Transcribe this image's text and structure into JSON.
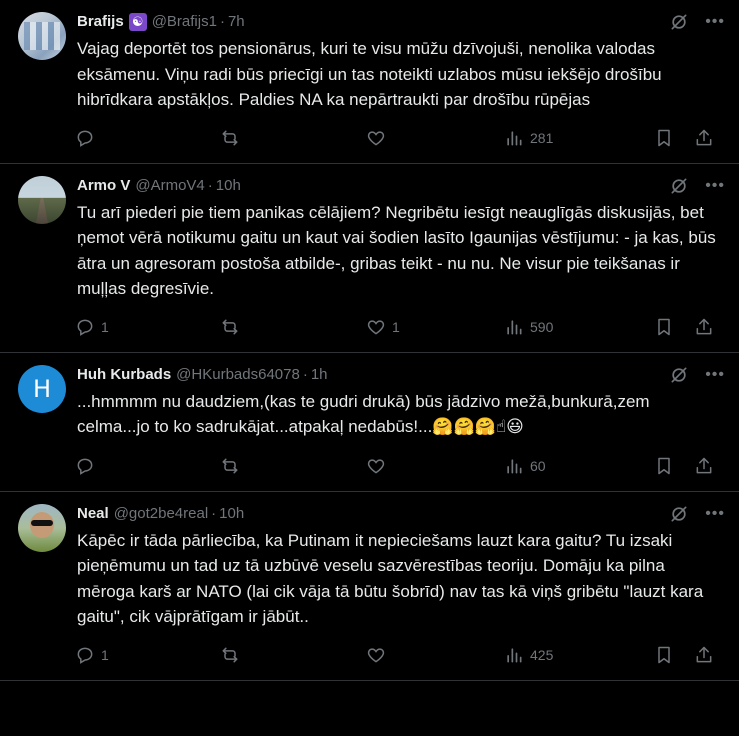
{
  "tweets": [
    {
      "name": "Brafijs",
      "badge": "☯",
      "handle": "@Brafijs1",
      "sep": "·",
      "time": "7h",
      "text": "Vajag deportēt tos pensionārus, kuri te visu mūžu dzīvojuši, nenolika valodas eksāmenu. Viņu radi būs priecīgi un tas noteikti uzlabos mūsu iekšējo drošību hibrīdkara apstākļos. Paldies NA ka nepārtraukti par drošību rūpējas",
      "replies": "",
      "retweets": "",
      "likes": "",
      "views": "281"
    },
    {
      "name": "Armo V",
      "handle": "@ArmoV4",
      "sep": "·",
      "time": "10h",
      "text": "Tu arī piederi pie tiem panikas cēlājiem? Negribētu iesīgt neauglīgās diskusijās, bet ņemot vērā notikumu gaitu un kaut vai šodien lasīto Igaunijas vēstījumu: - ja kas, būs ātra un agresoram postoša atbilde-, gribas teikt - nu nu. Ne visur pie teikšanas ir muļļas degresīvie.",
      "replies": "1",
      "retweets": "",
      "likes": "1",
      "views": "590"
    },
    {
      "name": "Huh Kurbads",
      "avatar_letter": "H",
      "handle": "@HKurbads64078",
      "sep": "·",
      "time": "1h",
      "text": "...hmmmm nu daudziem,(kas te gudri drukā) būs jādzivo mežā,bunkurā,zem celma...jo to ko sadrukājat...atpakaļ nedabūs!...",
      "emojis": "🤗🤗🤗☝😃",
      "replies": "",
      "retweets": "",
      "likes": "",
      "views": "60"
    },
    {
      "name": "Neal",
      "handle": "@got2be4real",
      "sep": "·",
      "time": "10h",
      "text": "Kāpēc ir tāda pārliecība, ka Putinam it nepieciešams lauzt kara gaitu? Tu izsaki pieņēmumu un tad uz tā uzbūvē veselu sazvērestības teoriju. Domāju ka pilna mēroga karš ar NATO (lai cik vāja tā būtu šobrīd) nav tas kā viņš gribētu \"lauzt kara gaitu\", cik vājprātīgam ir jābūt..",
      "replies": "1",
      "retweets": "",
      "likes": "",
      "views": "425"
    }
  ],
  "icons": {
    "more": "more-icon",
    "grok": "grok-icon",
    "reply": "reply-icon",
    "retweet": "retweet-icon",
    "like": "heart-icon",
    "views": "views-icon",
    "bookmark": "bookmark-icon",
    "share": "share-icon"
  },
  "colors": {
    "background": "#000000",
    "text": "#e7e9ea",
    "muted": "#71767b",
    "border": "#2f3336",
    "avatar_letter_bg": "#1d8bd6"
  }
}
